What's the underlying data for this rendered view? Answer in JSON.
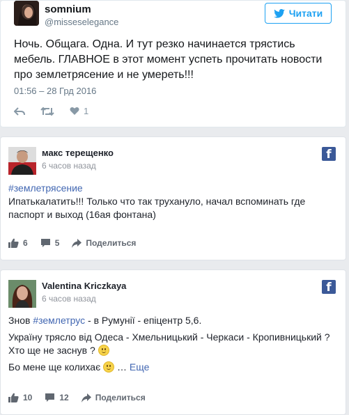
{
  "twitter": {
    "user_name": "somnium",
    "user_handle": "@misseselegance",
    "follow_label": "Читати",
    "text": "Ночь. Общага. Одна. И тут резко начинается трястись мебель. ГЛАВНОЕ в этот момент успеть прочитать новости про землетрясение и не умереть!!!",
    "date": "01:56 – 28 Грд 2016",
    "likes": "1",
    "accent": "#1da1f2"
  },
  "fb_posts": [
    {
      "author": "макс терещенко",
      "time": "6 часов назад",
      "hashtag": "#землетрясение",
      "body": "Ипатькалатить!!! Только что так труханулo, начал вспоминать где паспорт и выход (16ая фонтана)",
      "likes": "6",
      "comments": "5",
      "share_label": "Поделиться"
    },
    {
      "author": "Valentina Kriczkaya",
      "time": "6 часов назад",
      "line1_prefix": "Знов ",
      "hashtag": "#землетрус",
      "line1_suffix": " - в Румунії - епіцентр 5,6.",
      "line2": "Україну трясло від Одеса - Хмельницький - Черкаси - Кропивницький ? Хто ще не заснув ?",
      "line3": "Бо мене ще колихає",
      "ellipsis": " … ",
      "more_label": "Еще",
      "likes": "10",
      "comments": "12",
      "share_label": "Поделиться"
    }
  ],
  "colors": {
    "facebook": "#3b5998",
    "fb_link": "#4267b2"
  }
}
